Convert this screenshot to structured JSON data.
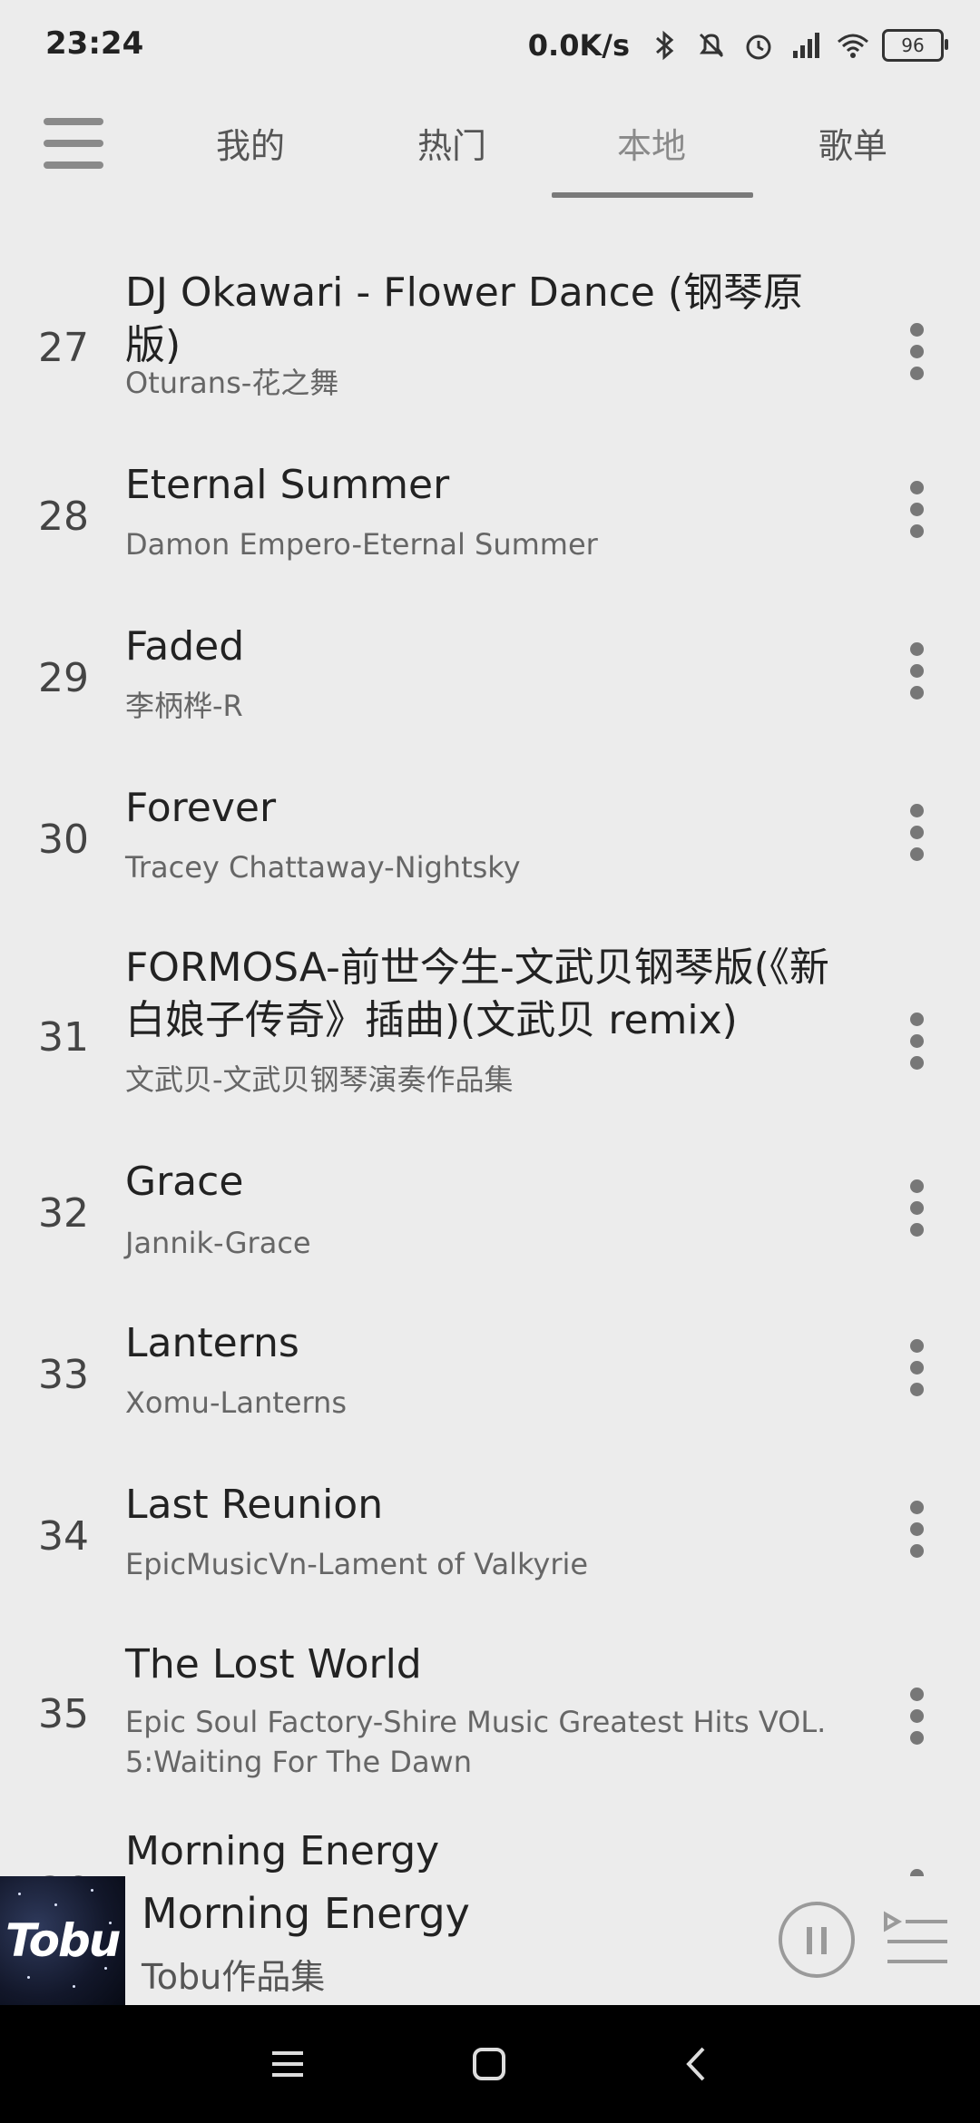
{
  "status_bar": {
    "time": "23:24",
    "net_speed": "0.0K/s",
    "battery": "96"
  },
  "tabs": [
    {
      "label": "我的"
    },
    {
      "label": "热门"
    },
    {
      "label": "本地"
    },
    {
      "label": "歌单"
    }
  ],
  "active_tab": "本地",
  "songs": [
    {
      "num": "27",
      "title": "DJ Okawari - Flower Dance (钢琴原版)",
      "subtitle": "Oturans-花之舞"
    },
    {
      "num": "28",
      "title": "Eternal Summer",
      "subtitle": "Damon Empero-Eternal Summer"
    },
    {
      "num": "29",
      "title": "Faded",
      "subtitle": "李柄桦-R"
    },
    {
      "num": "30",
      "title": "Forever",
      "subtitle": "Tracey Chattaway-Nightsky"
    },
    {
      "num": "31",
      "title": "FORMOSA-前世今生-文武贝钢琴版(《新白娘子传奇》插曲)(文武贝 remix)",
      "subtitle": "文武贝-文武贝钢琴演奏作品集"
    },
    {
      "num": "32",
      "title": "Grace",
      "subtitle": "Jannik-Grace"
    },
    {
      "num": "33",
      "title": "Lanterns",
      "subtitle": "Xomu-Lanterns"
    },
    {
      "num": "34",
      "title": "Last Reunion",
      "subtitle": "EpicMusicVn-Lament of Valkyrie"
    },
    {
      "num": "35",
      "title": "The Lost World",
      "subtitle": "Epic Soul Factory-Shire Music Greatest Hits VOL. 5:Waiting For The Dawn"
    },
    {
      "num": "36",
      "title": "Morning Energy",
      "subtitle": ""
    }
  ],
  "now_playing": {
    "title": "Morning Energy",
    "subtitle": "Tobu作品集",
    "album_art_text": "Tobu"
  },
  "colors": {
    "background": "#ececec",
    "navbar": "#000000",
    "accent_gray": "#7a7a7a"
  }
}
